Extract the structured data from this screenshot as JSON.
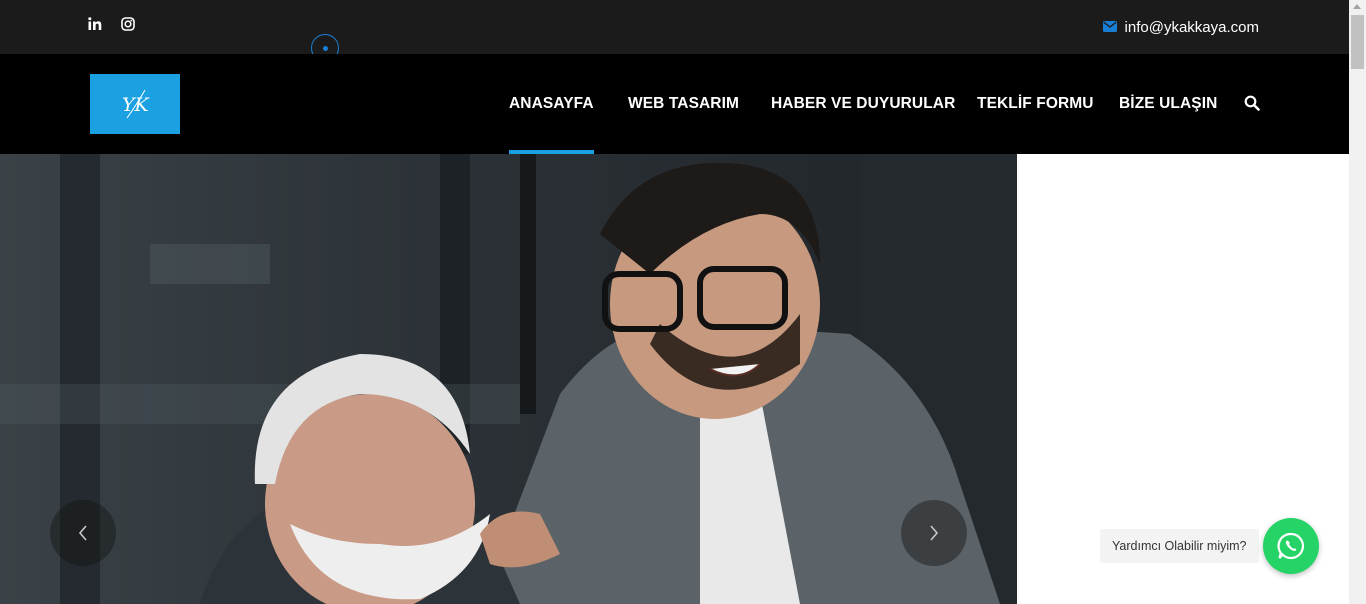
{
  "topbar": {
    "social": [
      {
        "icon": "linkedin-icon"
      },
      {
        "icon": "instagram-icon"
      }
    ],
    "email": {
      "icon": "envelope-icon",
      "text": "info@ykakkaya.com"
    }
  },
  "header": {
    "logo": {
      "text": "YK"
    },
    "nav": [
      {
        "label": "ANASAYFA",
        "active": true
      },
      {
        "label": "WEB TASARIM",
        "active": false
      },
      {
        "label": "HABER VE DUYURULAR",
        "active": false
      },
      {
        "label": "TEKLİF FORMU",
        "active": false
      },
      {
        "label": "BİZE ULAŞIN",
        "active": false
      }
    ],
    "search_icon": "search-icon"
  },
  "slider": {
    "prev_icon": "chevron-left-icon",
    "next_icon": "chevron-right-icon"
  },
  "chat": {
    "bubble_text": "Yardımcı Olabilir miyim?",
    "button_icon": "whatsapp-icon"
  },
  "colors": {
    "topbar": "#1b1b1b",
    "header": "#000000",
    "accent": "#1ba1e2",
    "whatsapp": "#25d366"
  }
}
